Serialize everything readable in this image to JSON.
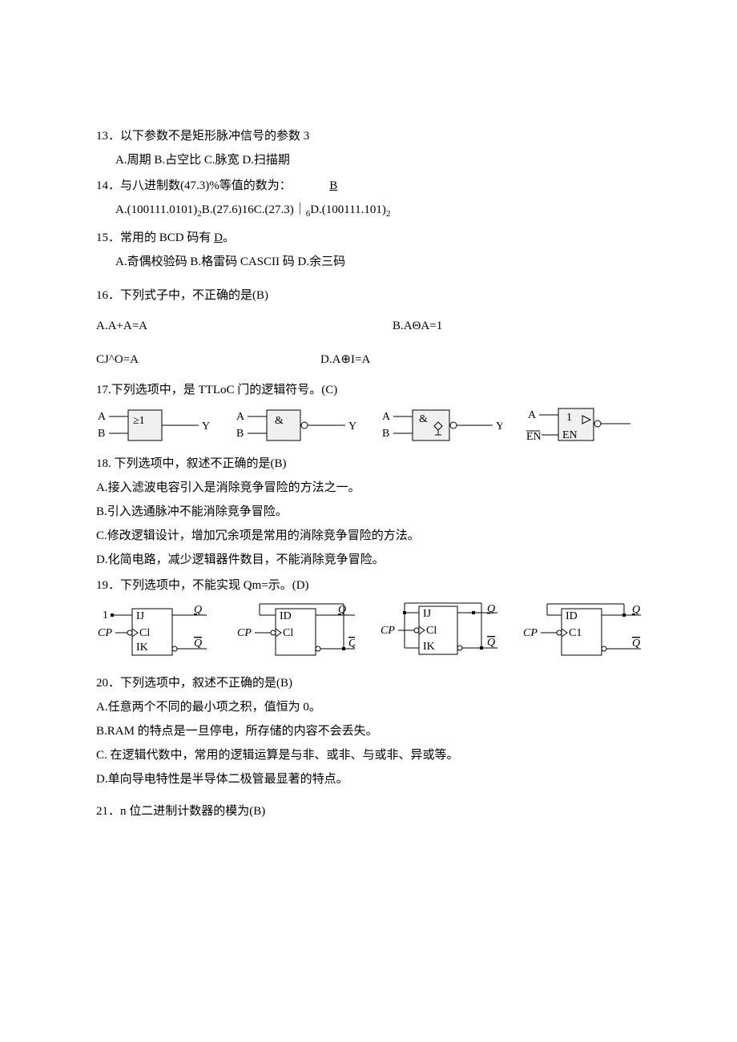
{
  "q13": {
    "num": "13",
    "text": "．以下参数不是矩形脉冲信号的参数 3",
    "opts": "A.周期 B.占空比 C.脉宽 D.扫描期"
  },
  "q14": {
    "num": "14",
    "text": "．与八进制数(47.3)%等值的数为：",
    "ans": "B",
    "opts_a": "A.(100111.0101)",
    "opts_a2": "2",
    "opts_b": "B.(27.6)16C.(27.3)｜",
    "opts_b2": "6",
    "opts_d": "D.(100111.101)",
    "opts_d2": "2"
  },
  "q15": {
    "num": "15",
    "text": "．常用的 BCD 码有 ",
    "ans": "D",
    "text2": "。",
    "opts": "A.奇偶校验码 B.格雷码 CASCII 码 D.余三码"
  },
  "q16": {
    "num": "16",
    "text": "．下列式子中，不正确的是(B)",
    "a": "A.A+A=A",
    "b": "B.AΘA=1",
    "c": "CJ^O=A",
    "d": "D.A⊕I=A"
  },
  "q17": {
    "text": "17.下列选项中，是 TTLoC 门的逻辑符号。(C)"
  },
  "q18": {
    "text": "18. 下列选项中，叙述不正确的是(B)",
    "a": "A.接入滤波电容引入是消除竞争冒险的方法之一。",
    "b": "B.引入选通脉冲不能消除竞争冒险。",
    "c": "C.修改逻辑设计，增加冗余项是常用的消除竞争冒险的方法。",
    "d": "D.化简电路，减少逻辑器件数目，不能消除竞争冒险。"
  },
  "q19": {
    "num": "19",
    "text": "．下列选项中，不能实现 Qm=示。(D)"
  },
  "q20": {
    "num": "20",
    "text": "．下列选项中，叙述不正确的是(B)",
    "a": "A.任意两个不同的最小项之积，值恒为 0。",
    "b": "B.RAM 的特点是一旦停电，所存储的内容不会丢失。",
    "c": "C. 在逻辑代数中，常用的逻辑运算是与非、或非、与或非、异或等。",
    "d": "D.单向导电特性是半导体二极管最显著的特点。"
  },
  "q21": {
    "num": "21",
    "text": "．n 位二进制计数器的模为(B)"
  },
  "gate_labels": {
    "A": "A",
    "B": "B",
    "Y": "Y",
    "EN": "EN",
    "ge1": "≥1",
    "amp": "&",
    "one": "1"
  },
  "flop_labels": {
    "one": "1",
    "CP": "CP",
    "Q": "Q",
    "Qbar": "Q",
    "IJ": "IJ",
    "IK": "IK",
    "Cl": "Cl",
    "ID": "ID",
    "C1": "C1"
  }
}
